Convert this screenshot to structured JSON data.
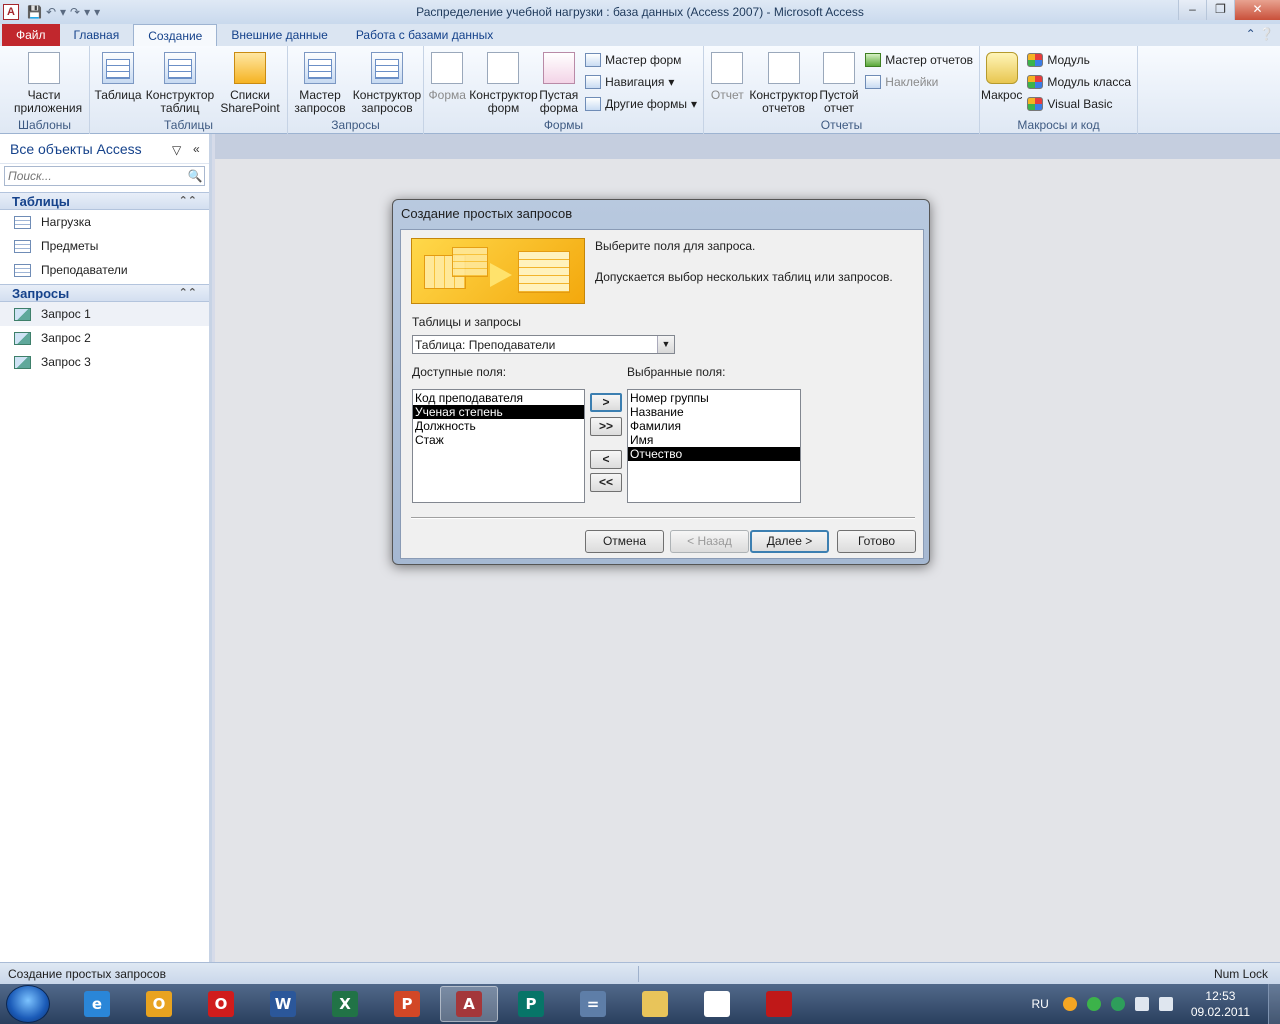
{
  "window": {
    "title": "Распределение учебной нагрузки : база данных (Access 2007)  -  Microsoft Access",
    "app_icon_letter": "A"
  },
  "ribbon_tabs": [
    "Файл",
    "Главная",
    "Создание",
    "Внешние данные",
    "Работа с базами данных"
  ],
  "ribbon": {
    "groups": {
      "templates": {
        "label": "Шаблоны",
        "app_parts": "Части приложения"
      },
      "tables": {
        "label": "Таблицы",
        "table": "Таблица",
        "table_design": "Конструктор таблиц",
        "sharepoint": "Списки SharePoint"
      },
      "queries": {
        "label": "Запросы",
        "wizard": "Мастер запросов",
        "design": "Конструктор запросов"
      },
      "forms": {
        "label": "Формы",
        "form": "Форма",
        "form_design": "Конструктор форм",
        "blank_form": "Пустая форма",
        "form_wizard": "Мастер форм",
        "navigation": "Навигация",
        "more_forms": "Другие формы"
      },
      "reports": {
        "label": "Отчеты",
        "report": "Отчет",
        "report_design": "Конструктор отчетов",
        "blank_report": "Пустой отчет",
        "report_wizard": "Мастер отчетов",
        "labels": "Наклейки"
      },
      "macros": {
        "label": "Макросы и код",
        "macro": "Макрос",
        "module": "Модуль",
        "class_module": "Модуль класса",
        "vba": "Visual Basic"
      }
    }
  },
  "nav_pane": {
    "header": "Все объекты Access",
    "search_placeholder": "Поиск...",
    "tables_section": "Таблицы",
    "tables": [
      "Нагрузка",
      "Предметы",
      "Преподаватели"
    ],
    "queries_section": "Запросы",
    "queries": [
      "Запрос 1",
      "Запрос 2",
      "Запрос 3"
    ]
  },
  "dialog": {
    "title": "Создание простых запросов",
    "instruction": "Выберите поля для запроса.",
    "note": "Допускается выбор нескольких таблиц или запросов.",
    "tables_label": "Таблицы и запросы",
    "tables_value": "Таблица: Преподаватели",
    "available_label": "Доступные поля:",
    "available_fields": [
      "Код преподавателя",
      "Ученая степень",
      "Должность",
      "Стаж"
    ],
    "available_selected": 1,
    "selected_label": "Выбранные поля:",
    "selected_fields": [
      "Номер группы",
      "Название",
      "Фамилия",
      "Имя",
      "Отчество"
    ],
    "selected_selected": 4,
    "move_buttons": {
      "one": ">",
      "all": ">>",
      "back_one": "<",
      "back_all": "<<"
    },
    "buttons": {
      "cancel": "Отмена",
      "back": "< Назад",
      "next": "Далее >",
      "finish": "Готово"
    }
  },
  "statusbar": {
    "left": "Создание простых запросов",
    "right": "Num Lock"
  },
  "taskbar": {
    "language": "RU",
    "time": "12:53",
    "date": "09.02.2011",
    "apps": [
      "ie-icon",
      "outlook-icon",
      "opera-icon",
      "word-icon",
      "excel-icon",
      "powerpoint-icon",
      "access-icon",
      "publisher-icon",
      "calculator-icon",
      "explorer-icon",
      "notepad-icon",
      "acrobat-icon"
    ],
    "app_letters": [
      "e",
      "O",
      "O",
      "W",
      "X",
      "P",
      "A",
      "P",
      "=",
      "",
      "",
      ""
    ],
    "app_colors": [
      "#2a86d8",
      "#e8a320",
      "#d01c1c",
      "#2b579a",
      "#217346",
      "#d24726",
      "#a4373a",
      "#077568",
      "#5e7ea8",
      "#e8c45a",
      "#ffffff",
      "#c01818"
    ]
  }
}
